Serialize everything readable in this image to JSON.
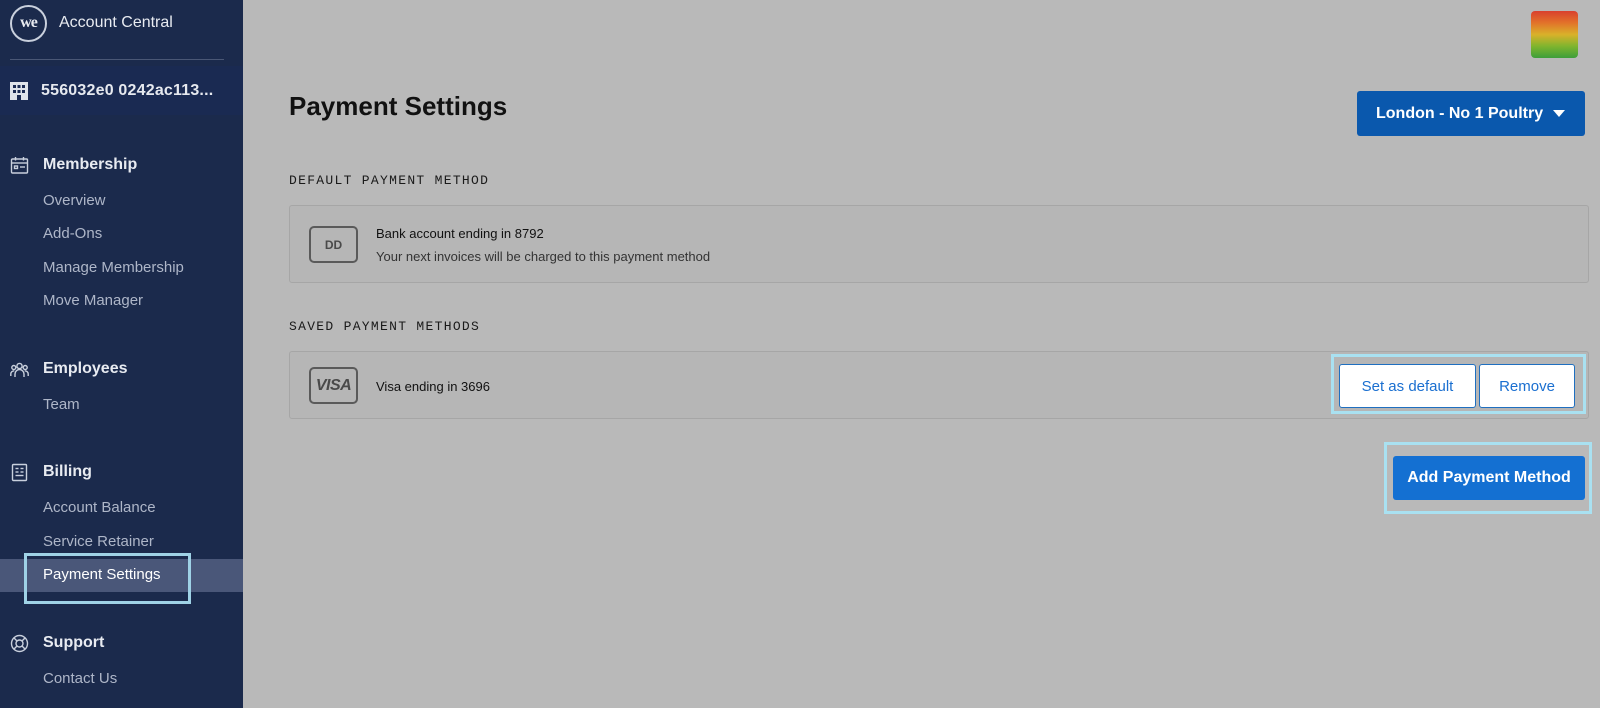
{
  "app": {
    "brand_logo_text": "we",
    "brand_name": "Account Central",
    "account_id": "556032e0 0242ac113...",
    "avatar_colors": [
      "#d9402e",
      "#e2722a",
      "#d9b12a",
      "#7fb52e",
      "#3d9e3a"
    ]
  },
  "sidebar": {
    "sections": [
      {
        "label": "Membership",
        "icon": "calendar-icon",
        "items": [
          "Overview",
          "Add-Ons",
          "Manage Membership",
          "Move Manager"
        ]
      },
      {
        "label": "Employees",
        "icon": "people-icon",
        "items": [
          "Team"
        ]
      },
      {
        "label": "Billing",
        "icon": "receipt-icon",
        "items": [
          "Account Balance",
          "Service Retainer",
          "Payment Settings"
        ],
        "active_item": "Payment Settings"
      },
      {
        "label": "Support",
        "icon": "lifebuoy-icon",
        "items": [
          "Contact Us"
        ]
      }
    ]
  },
  "main": {
    "title": "Payment Settings",
    "location_selector": "London - No 1 Poultry",
    "default_section_label": "DEFAULT PAYMENT METHOD",
    "default_method": {
      "badge": "DD",
      "title": "Bank account ending in 8792",
      "subtitle": "Your next invoices will be charged to this payment method"
    },
    "saved_section_label": "SAVED PAYMENT METHODS",
    "saved_methods": [
      {
        "badge": "VISA",
        "title": "Visa ending in 3696"
      }
    ],
    "set_default_label": "Set as default",
    "remove_label": "Remove",
    "add_button_label": "Add Payment Method"
  },
  "colors": {
    "sidebar_bg": "#1b2a4c",
    "primary": "#1470d2",
    "location_button": "#0a58ad",
    "highlight": "#a9e1f1"
  }
}
